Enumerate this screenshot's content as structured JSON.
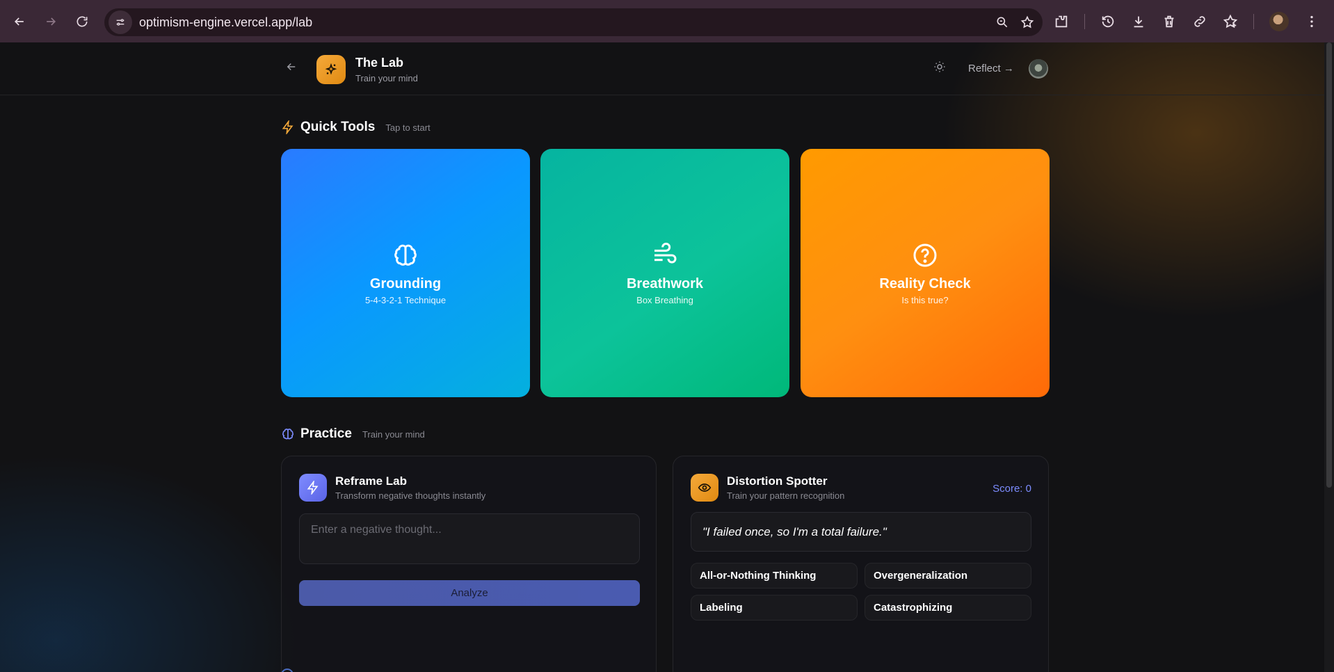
{
  "browser": {
    "url": "optimism-engine.vercel.app/lab"
  },
  "header": {
    "title": "The Lab",
    "subtitle": "Train your mind",
    "reflect_label": "Reflect →"
  },
  "quick_tools": {
    "title": "Quick Tools",
    "subtitle": "Tap to start",
    "cards": [
      {
        "title": "Grounding",
        "subtitle": "5-4-3-2-1 Technique",
        "icon": "brain-icon",
        "color": "#0a98ff"
      },
      {
        "title": "Breathwork",
        "subtitle": "Box Breathing",
        "icon": "wind-icon",
        "color": "#0cc39a"
      },
      {
        "title": "Reality Check",
        "subtitle": "Is this true?",
        "icon": "question-circle-icon",
        "color": "#ff8f10"
      }
    ]
  },
  "practice": {
    "title": "Practice",
    "subtitle": "Train your mind",
    "reframe": {
      "title": "Reframe Lab",
      "subtitle": "Transform negative thoughts instantly",
      "placeholder": "Enter a negative thought...",
      "value": "",
      "button_label": "Analyze"
    },
    "distortion": {
      "title": "Distortion Spotter",
      "subtitle": "Train your pattern recognition",
      "score_label": "Score: 0",
      "quote": "\"I failed once, so I'm a total failure.\"",
      "options": [
        "All-or-Nothing Thinking",
        "Overgeneralization",
        "Labeling",
        "Catastrophizing"
      ]
    }
  },
  "colors": {
    "accent_orange": "#f5a93a",
    "accent_indigo": "#7c8cff",
    "background": "#121214"
  }
}
